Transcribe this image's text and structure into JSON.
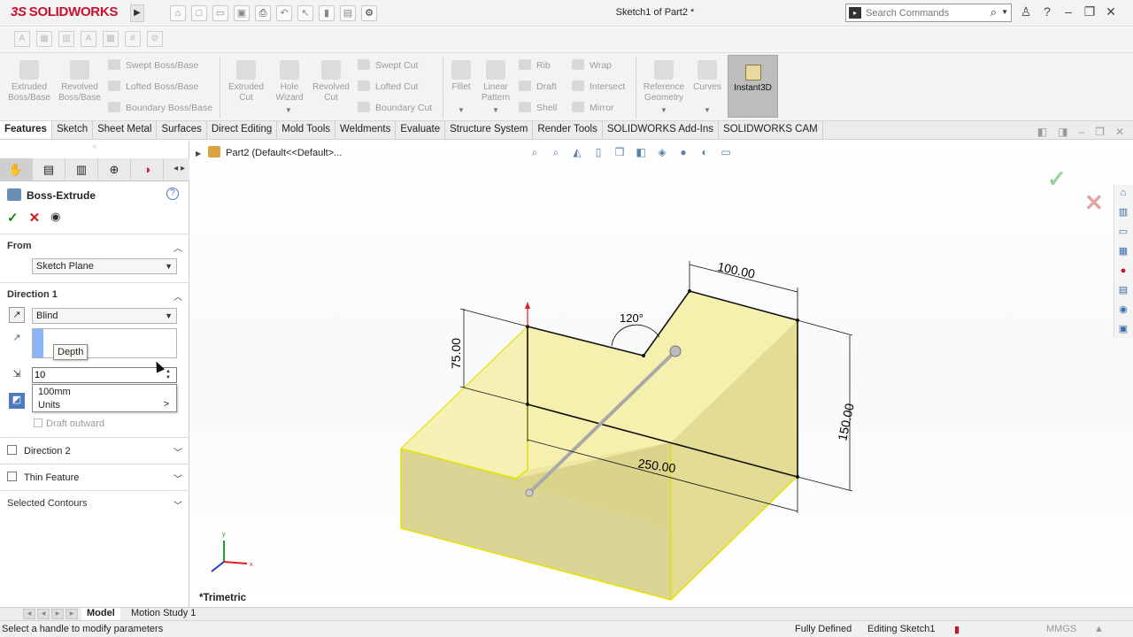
{
  "app": {
    "logo_ds": "3S",
    "logo_name": "SOLIDWORKS",
    "document_title": "Sketch1 of Part2 *"
  },
  "search": {
    "placeholder": "Search Commands"
  },
  "ribbon": {
    "extruded_boss": "Extruded Boss/Base",
    "revolved_boss": "Revolved Boss/Base",
    "swept_boss": "Swept Boss/Base",
    "lofted_boss": "Lofted Boss/Base",
    "boundary_boss": "Boundary Boss/Base",
    "extruded_cut": "Extruded Cut",
    "hole_wizard": "Hole Wizard",
    "revolved_cut": "Revolved Cut",
    "swept_cut": "Swept Cut",
    "lofted_cut": "Lofted Cut",
    "boundary_cut": "Boundary Cut",
    "fillet": "Fillet",
    "linear_pattern": "Linear Pattern",
    "rib": "Rib",
    "draft": "Draft",
    "shell": "Shell",
    "wrap": "Wrap",
    "intersect": "Intersect",
    "mirror": "Mirror",
    "reference_geometry": "Reference Geometry",
    "curves": "Curves",
    "instant3d": "Instant3D"
  },
  "tabs": [
    "Features",
    "Sketch",
    "Sheet Metal",
    "Surfaces",
    "Direct Editing",
    "Mold Tools",
    "Weldments",
    "Evaluate",
    "Structure System",
    "Render Tools",
    "SOLIDWORKS Add-Ins",
    "SOLIDWORKS CAM"
  ],
  "property_manager": {
    "title": "Boss-Extrude",
    "from_label": "From",
    "from_value": "Sketch Plane",
    "direction1_label": "Direction 1",
    "end_condition": "Blind",
    "tooltip": "Depth",
    "depth_value": "10",
    "units_value": "100mm",
    "units_label": "Units",
    "units_arrow": ">",
    "draft_outward": "Draft outward",
    "direction2_label": "Direction 2",
    "thin_feature_label": "Thin Feature",
    "selected_contours_label": "Selected Contours"
  },
  "viewport": {
    "breadcrumb": "Part2  (Default<<Default>...",
    "view_label": "*Trimetric",
    "dim_width": "100.00",
    "dim_angle": "120°",
    "dim_left_height": "75.00",
    "dim_right_height": "150.00",
    "dim_length": "250.00",
    "axis_x": "x",
    "axis_y": "y"
  },
  "bottom_tabs": [
    "Model",
    "Motion Study 1"
  ],
  "status": {
    "hint": "Select a handle to modify parameters",
    "state": "Fully Defined",
    "editing": "Editing Sketch1",
    "units": "MMGS"
  },
  "colors": {
    "brand": "#c8102e",
    "solid_face": "#f3eea2",
    "ok": "#1d8a1d",
    "cancel": "#c91c1c"
  }
}
